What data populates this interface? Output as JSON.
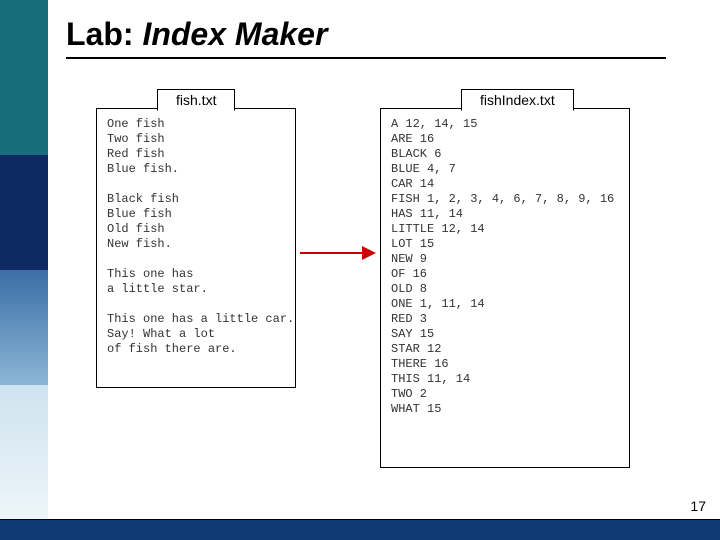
{
  "title_prefix": "Lab: ",
  "title_ital": "Index Maker",
  "left_tab": "fish.txt",
  "right_tab": "fishIndex.txt",
  "left_file": "One fish\nTwo fish\nRed fish\nBlue fish.\n\nBlack fish\nBlue fish\nOld fish\nNew fish.\n\nThis one has\na little star.\n\nThis one has a little car.\nSay! What a lot\nof fish there are.",
  "right_file": "A 12, 14, 15\nARE 16\nBLACK 6\nBLUE 4, 7\nCAR 14\nFISH 1, 2, 3, 4, 6, 7, 8, 9, 16\nHAS 11, 14\nLITTLE 12, 14\nLOT 15\nNEW 9\nOF 16\nOLD 8\nONE 1, 11, 14\nRED 3\nSAY 15\nSTAR 12\nTHERE 16\nTHIS 11, 14\nTWO 2\nWHAT 15",
  "page_number": "17"
}
